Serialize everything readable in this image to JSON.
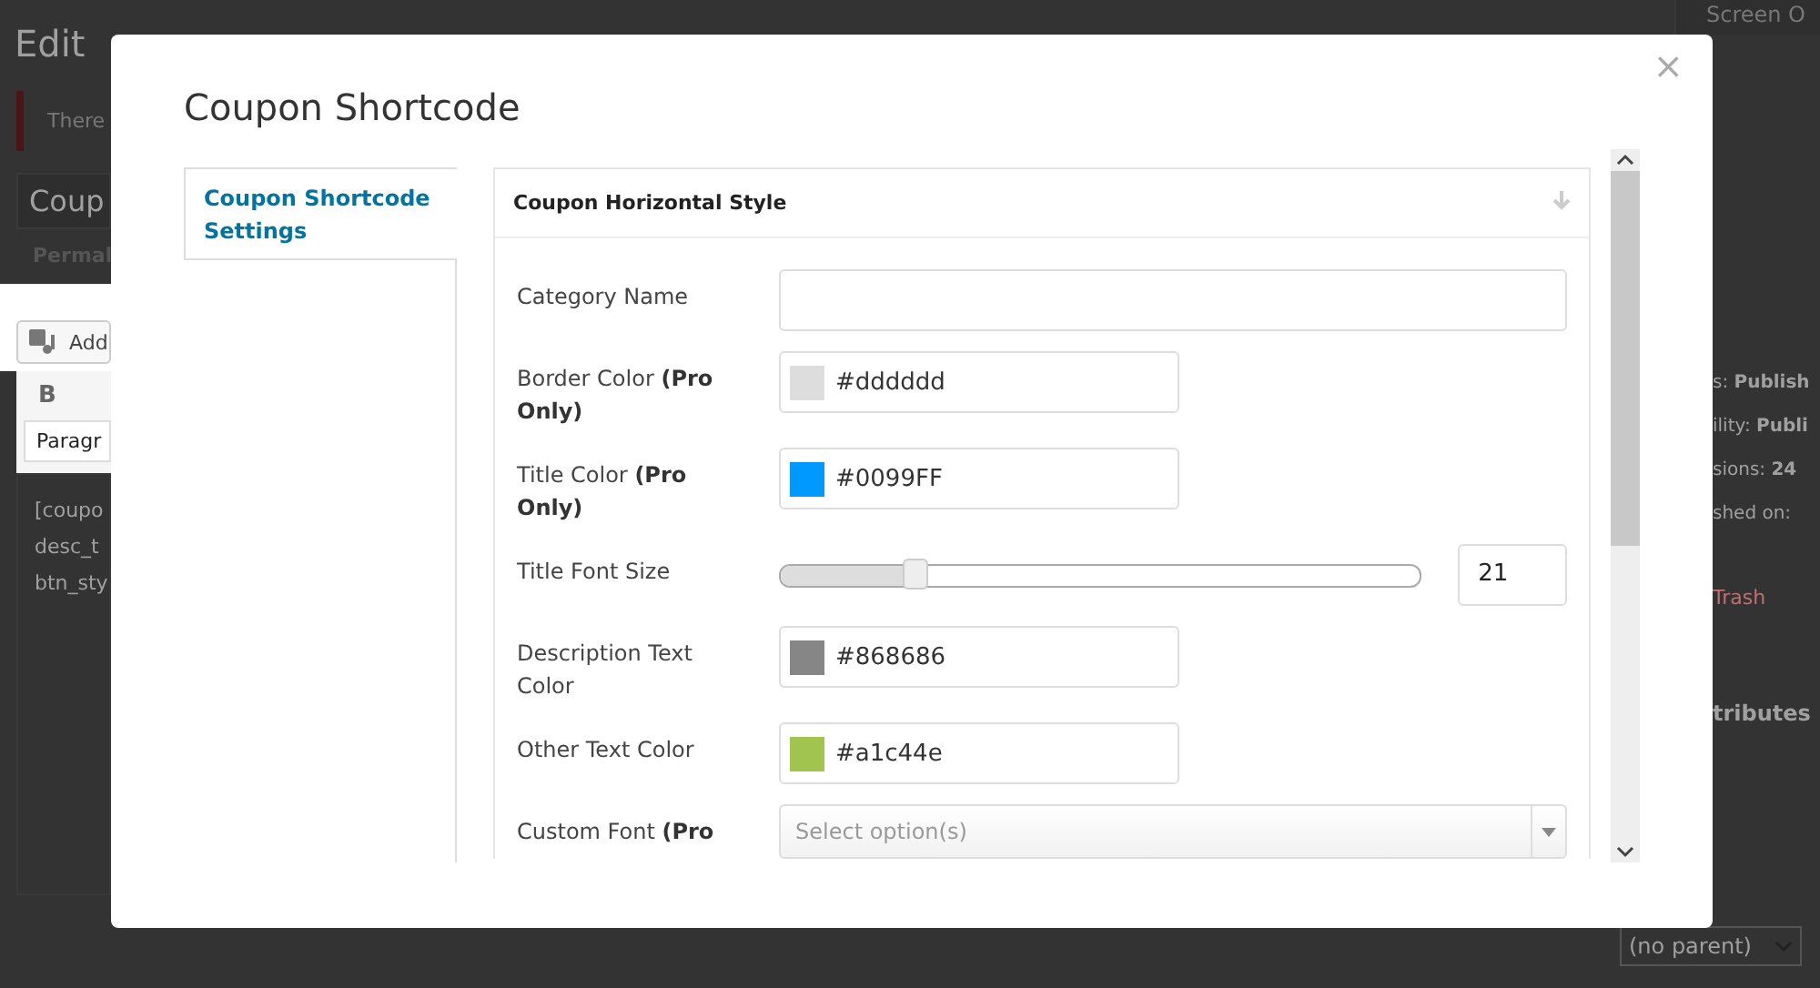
{
  "background": {
    "screen_options": "Screen O",
    "heading": "Edit",
    "notice": "There",
    "post_title": "Coup",
    "permalink": "Permal",
    "add_media": "Add",
    "bold_button": "B",
    "format_select": "Paragr",
    "content_lines": [
      "[coupo",
      "desc_t",
      "btn_sty"
    ],
    "publish_lines": [
      "s: **Publish**",
      "ility: **Publi**",
      "sions: **24**",
      "shed on:"
    ],
    "trash": "Trash",
    "attributes_heading": "tributes",
    "parent_select": "(no parent)"
  },
  "modal": {
    "title": "Coupon Shortcode",
    "close": "×",
    "tabs": [
      {
        "label": "Coupon Shortcode Settings",
        "selected": true
      }
    ],
    "section": {
      "title": "Coupon Horizontal Style",
      "fields": [
        {
          "kind": "text",
          "label": "Category Name"
        },
        {
          "kind": "color",
          "label": "Border Color **(Pro Only)**",
          "value": "#dddddd",
          "color": "#dddddd"
        },
        {
          "kind": "color",
          "label": "Title Color **(Pro Only)**",
          "value": "#0099FF",
          "color": "#0099ff"
        },
        {
          "kind": "slider",
          "label": "Title Font Size",
          "level": 0.21,
          "value": "21"
        },
        {
          "kind": "color",
          "label": "Description Text Color",
          "value": "#868686",
          "color": "#868686"
        },
        {
          "kind": "color",
          "label": "Other Text Color",
          "value": "#a1c44e",
          "color": "#a1c44e"
        },
        {
          "kind": "select",
          "label": "Custom Font **(Pro**",
          "placeholder": "Select option(s)"
        }
      ]
    }
  }
}
